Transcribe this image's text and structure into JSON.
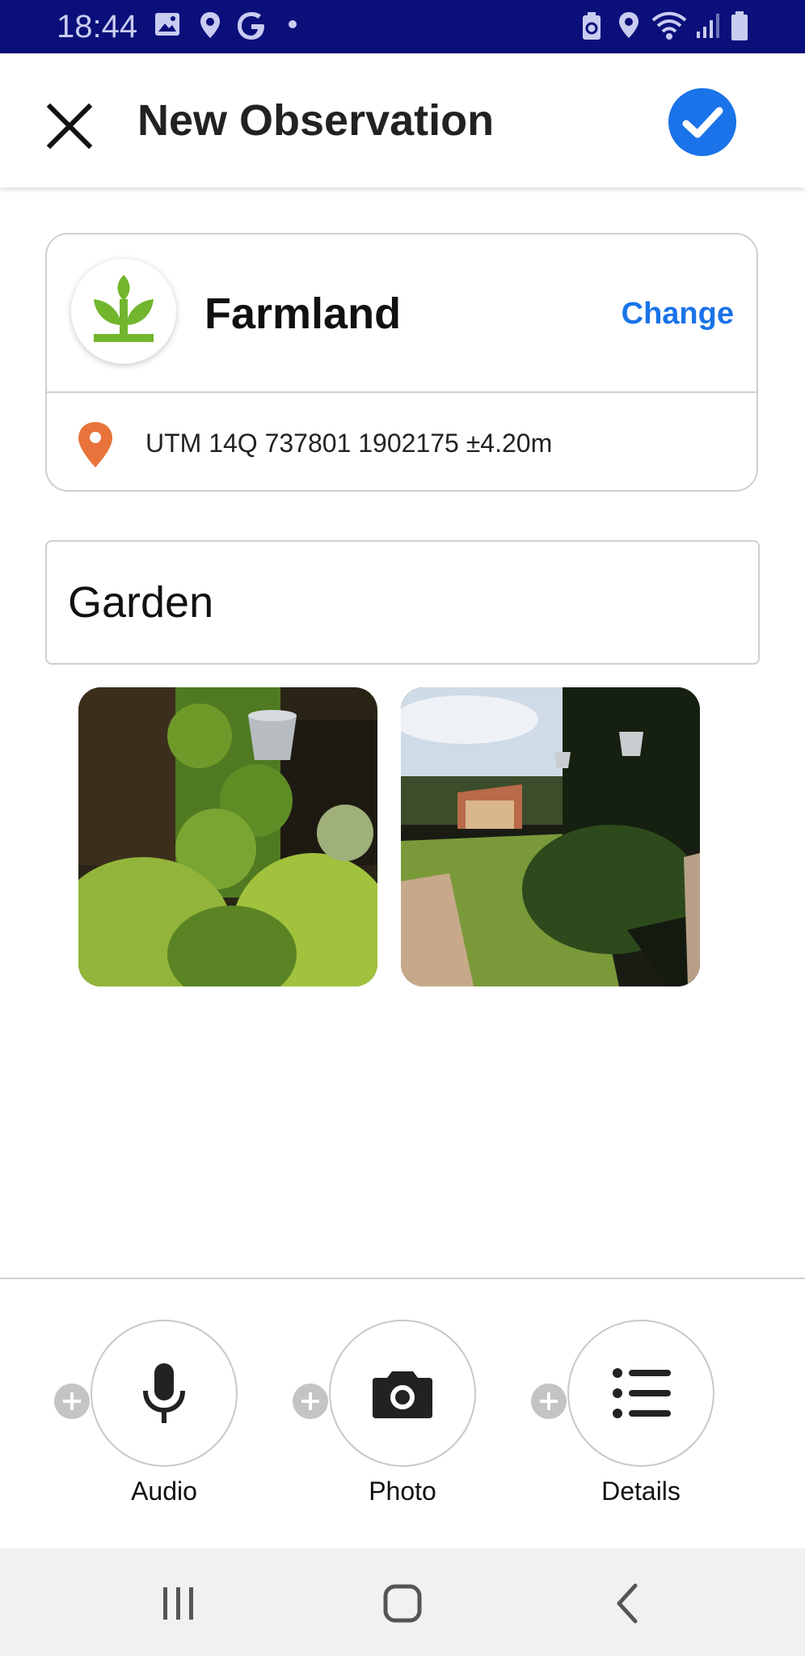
{
  "status_bar": {
    "time": "18:44",
    "left_icons": [
      "image-icon",
      "location-pin-icon",
      "google-g-icon",
      "dot-icon"
    ],
    "right_icons": [
      "data-saver-icon",
      "location-pin-icon",
      "wifi-icon",
      "signal-icon",
      "battery-icon"
    ]
  },
  "header": {
    "title": "New Observation",
    "close_icon": "close-icon",
    "confirm_icon": "check-icon",
    "accent": "#1a73e8"
  },
  "preset": {
    "name": "Farmland",
    "change_label": "Change",
    "icon": "sprout-icon",
    "icon_color": "#72b62e"
  },
  "location": {
    "text": "UTM 14Q 737801 1902175 ±4.20m",
    "icon": "location-pin-icon",
    "icon_color": "#e8743b"
  },
  "notes": {
    "value": "Garden"
  },
  "photos": [
    {
      "alt": "garden-photo-1"
    },
    {
      "alt": "garden-photo-2"
    }
  ],
  "actions": [
    {
      "label": "Audio",
      "icon": "microphone-icon"
    },
    {
      "label": "Photo",
      "icon": "camera-icon"
    },
    {
      "label": "Details",
      "icon": "list-icon"
    }
  ],
  "nav": {
    "recents_icon": "recents-icon",
    "home_icon": "home-icon",
    "back_icon": "back-icon"
  }
}
